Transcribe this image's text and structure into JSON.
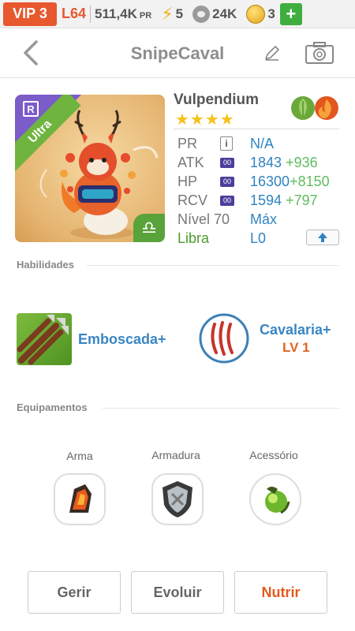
{
  "status_bar": {
    "vip": "VIP 3",
    "level": "L64",
    "power": "511,4K",
    "power_unit": "PR",
    "energy": "5",
    "paws": "24K",
    "coins": "3",
    "plus": "+"
  },
  "header": {
    "title": "SnipeCaval"
  },
  "monster": {
    "rarity_badge": "R",
    "rarity": "Ultra",
    "name": "Vulpendium",
    "stars": "★★★★",
    "zodiac_symbol": "♎",
    "stats": {
      "pr_label": "PR",
      "pr_info": "i",
      "pr_value": "N/A",
      "atk_label": "ATK",
      "atk_tag": "00",
      "atk_value": "1843",
      "atk_bonus": "+936",
      "hp_label": "HP",
      "hp_tag": "00",
      "hp_value": "16300",
      "hp_bonus": "+8150",
      "rcv_label": "RCV",
      "rcv_tag": "00",
      "rcv_value": "1594",
      "rcv_bonus": "+797",
      "level_label": "Nível 70",
      "level_value": "Máx",
      "zodiac_label": "Libra",
      "zodiac_value": "L0"
    }
  },
  "sections": {
    "skills": "Habilidades",
    "equipment": "Equipamentos"
  },
  "skills": [
    {
      "name": "Emboscada+",
      "level": ""
    },
    {
      "name": "Cavalaria+",
      "level": "LV 1"
    }
  ],
  "equipment": [
    {
      "label": "Arma"
    },
    {
      "label": "Armadura"
    },
    {
      "label": "Acessório"
    }
  ],
  "actions": {
    "manage": "Gerir",
    "evolve": "Evoluir",
    "feed": "Nutrir"
  },
  "colors": {
    "accent_orange": "#e8582f",
    "stat_blue": "#2f84c1",
    "bonus_green": "#61bb61",
    "libra_green": "#4a9b2b"
  }
}
